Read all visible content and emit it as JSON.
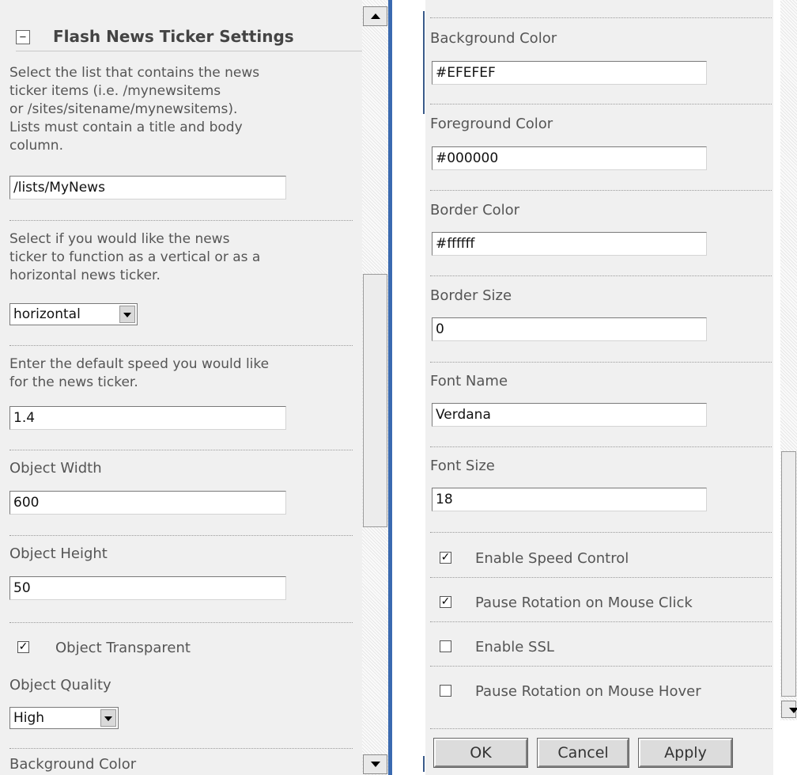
{
  "section": {
    "collapse_glyph": "−",
    "title": "Flash News Ticker Settings"
  },
  "left": {
    "list_desc": "Select the list that contains the news\nticker items (i.e. /mynewsitems\nor /sites/sitename/mynewsitems).\nLists must contain a title and body\ncolumn.",
    "list_value": "/lists/MyNews",
    "orient_desc": "Select if you would like the news\nticker to function as a vertical or as a\nhorizontal news ticker.",
    "orient_value": "horizontal",
    "speed_desc": "Enter the default speed you would like\nfor the news ticker.",
    "speed_value": "1.4",
    "width_label": "Object Width",
    "width_value": "600",
    "height_label": "Object Height",
    "height_value": "50",
    "transparent_label": "Object Transparent",
    "transparent_checked": true,
    "quality_label": "Object Quality",
    "quality_value": "High",
    "bg_label_partial": "Background Color"
  },
  "right": {
    "bg_label": "Background Color",
    "bg_value": "#EFEFEF",
    "fg_label": "Foreground Color",
    "fg_value": "#000000",
    "border_color_label": "Border Color",
    "border_color_value": "#ffffff",
    "border_size_label": "Border Size",
    "border_size_value": "0",
    "font_name_label": "Font Name",
    "font_name_value": "Verdana",
    "font_size_label": "Font Size",
    "font_size_value": "18",
    "checkboxes": [
      {
        "label": "Enable Speed Control",
        "checked": true
      },
      {
        "label": "Pause Rotation on Mouse Click",
        "checked": true
      },
      {
        "label": "Enable SSL",
        "checked": false
      },
      {
        "label": "Pause Rotation on Mouse Hover",
        "checked": false
      }
    ]
  },
  "buttons": {
    "ok": "OK",
    "cancel": "Cancel",
    "apply": "Apply"
  },
  "check_glyph": "✓",
  "colors": {
    "accent_bar": "#3a6ab0",
    "panel_bg": "#f0f0f0"
  }
}
